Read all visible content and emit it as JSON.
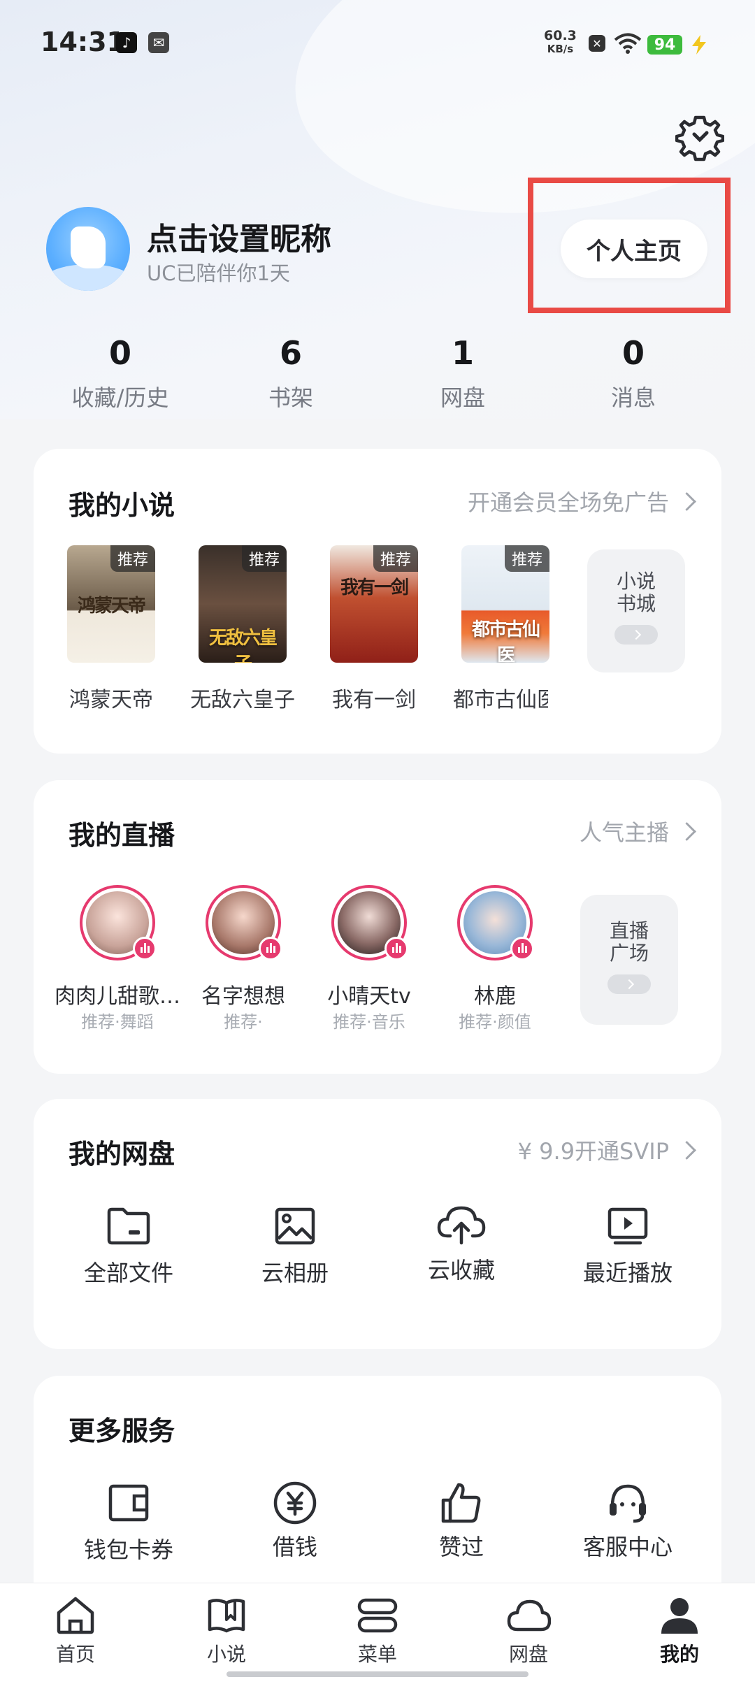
{
  "status_bar": {
    "time": "14:31",
    "net_speed_value": "60.3",
    "net_speed_unit": "KB/s",
    "battery": "94"
  },
  "header": {
    "nickname": "点击设置昵称",
    "accompany": "UC已陪伴你1天",
    "profile_button": "个人主页"
  },
  "stats": [
    {
      "value": "0",
      "label": "收藏/历史"
    },
    {
      "value": "6",
      "label": "书架"
    },
    {
      "value": "1",
      "label": "网盘"
    },
    {
      "value": "0",
      "label": "消息"
    }
  ],
  "novels": {
    "title": "我的小说",
    "link": "开通会员全场免广告",
    "books": [
      {
        "name": "鸿蒙天帝",
        "tag": "推荐",
        "cover_text": "鸿蒙天帝",
        "color": "#8a7a6a"
      },
      {
        "name": "无敌六皇子",
        "tag": "推荐",
        "cover_text": "无敌六皇子",
        "color": "#4a3a30"
      },
      {
        "name": "我有一剑",
        "tag": "推荐",
        "cover_text": "我有一剑",
        "color": "#a04030"
      },
      {
        "name": "都市古仙医",
        "tag": "推荐",
        "cover_text": "都市古仙医",
        "color": "#d8e4ee"
      }
    ],
    "store_line1": "小说",
    "store_line2": "书城"
  },
  "live": {
    "title": "我的直播",
    "link": "人气主播",
    "streamers": [
      {
        "name": "肉肉儿甜歌…",
        "sub": "推荐·舞蹈"
      },
      {
        "name": "名字想想",
        "sub": "推荐·"
      },
      {
        "name": "小晴天tv",
        "sub": "推荐·音乐"
      },
      {
        "name": "林鹿",
        "sub": "推荐·颜值"
      }
    ],
    "plaza_line1": "直播",
    "plaza_line2": "广场"
  },
  "drive": {
    "title": "我的网盘",
    "link": "¥ 9.9开通SVIP",
    "items": [
      {
        "label": "全部文件",
        "icon": "folder-icon"
      },
      {
        "label": "云相册",
        "icon": "photo-icon"
      },
      {
        "label": "云收藏",
        "icon": "cloud-upload-icon"
      },
      {
        "label": "最近播放",
        "icon": "play-screen-icon"
      }
    ]
  },
  "services": {
    "title": "更多服务",
    "items": [
      {
        "label": "钱包卡券",
        "icon": "wallet-icon"
      },
      {
        "label": "借钱",
        "icon": "yen-coin-icon"
      },
      {
        "label": "赞过",
        "icon": "thumbs-up-icon"
      },
      {
        "label": "客服中心",
        "icon": "headset-icon"
      }
    ]
  },
  "nav": [
    {
      "label": "首页",
      "icon": "home-icon"
    },
    {
      "label": "小说",
      "icon": "book-icon"
    },
    {
      "label": "菜单",
      "icon": "menu-icon"
    },
    {
      "label": "网盘",
      "icon": "cloud-icon"
    },
    {
      "label": "我的",
      "icon": "person-icon"
    }
  ],
  "colors": {
    "accent_red": "#e94a45",
    "live_pink": "#e63a6e",
    "battery_green": "#3dbb3d"
  }
}
